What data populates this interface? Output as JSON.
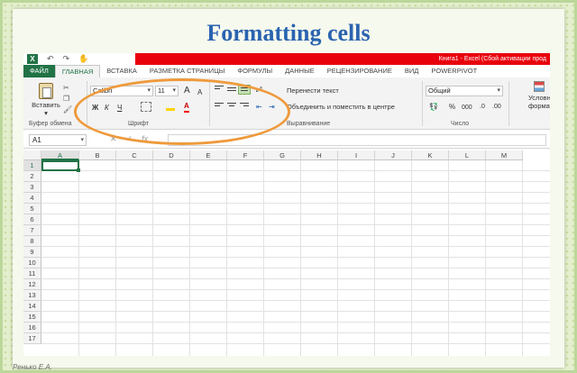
{
  "slide": {
    "title": "Formatting cells",
    "author": "Ренько Е.А."
  },
  "window": {
    "app_icon": "X",
    "qa_undo": "↶",
    "qa_redo": "↷",
    "qa_touch": "✋",
    "title_text": "Книга1 - Excel (Сбой активации прод"
  },
  "tabs": [
    {
      "label": "ФАЙЛ"
    },
    {
      "label": "ГЛАВНАЯ"
    },
    {
      "label": "ВСТАВКА"
    },
    {
      "label": "РАЗМЕТКА СТРАНИЦЫ"
    },
    {
      "label": "ФОРМУЛЫ"
    },
    {
      "label": "ДАННЫЕ"
    },
    {
      "label": "РЕЦЕНЗИРОВАНИЕ"
    },
    {
      "label": "ВИД"
    },
    {
      "label": "POWERPIVOT"
    }
  ],
  "ribbon": {
    "paste_label": "Вставить",
    "paste_arrow": "▾",
    "clipboard_group": "Буфер обмена",
    "font_name": "Calibri",
    "font_size": "11",
    "grow_font": "A",
    "shrink_font": "A",
    "bold": "Ж",
    "italic": "К",
    "underline": "Ч",
    "font_color_letter": "A",
    "font_group": "Шрифт",
    "wrap_text": "Перенести текст",
    "merge_center": "Объединить и поместить в центре",
    "alignment_group": "Выравнивание",
    "number_format": "Общий",
    "percent": "%",
    "thousands": "000",
    "number_group": "Число",
    "conditional": "Условное",
    "conditional2": "форматиро"
  },
  "formula_bar": {
    "name_box": "A1",
    "cancel": "✕",
    "enter": "✓",
    "fx": "fx"
  },
  "grid": {
    "columns": [
      "A",
      "B",
      "C",
      "D",
      "E",
      "F",
      "G",
      "H",
      "I",
      "J",
      "K",
      "L",
      "M"
    ],
    "rows": [
      "1",
      "2",
      "3",
      "4",
      "5",
      "6",
      "7",
      "8",
      "9",
      "10",
      "11",
      "12",
      "13",
      "14",
      "15",
      "16",
      "17"
    ]
  },
  "colors": {
    "excel_green": "#217346",
    "title_blue": "#2a63b0",
    "highlight_orange": "#ee9a3c",
    "activation_red": "#e8000c"
  }
}
